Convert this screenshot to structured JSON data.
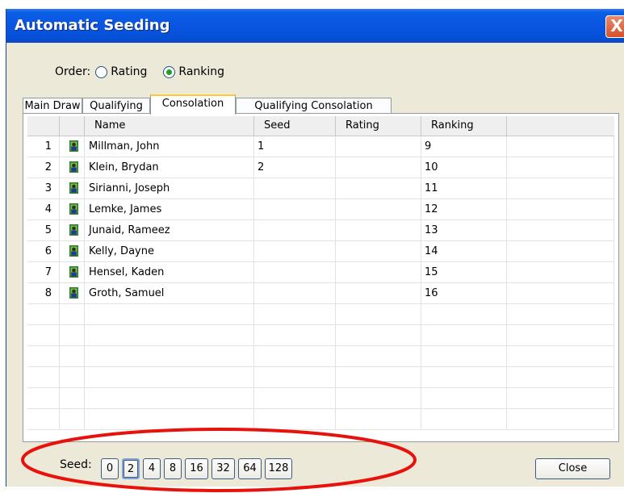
{
  "window": {
    "title": "Automatic Seeding",
    "close_glyph": "X"
  },
  "order": {
    "label": "Order:",
    "options": [
      {
        "label": "Rating",
        "checked": false
      },
      {
        "label": "Ranking",
        "checked": true
      }
    ]
  },
  "tabs": [
    {
      "label": "Main Draw",
      "active": false
    },
    {
      "label": "Qualifying",
      "active": false
    },
    {
      "label": "Consolation",
      "active": true
    },
    {
      "label": "Qualifying Consolation",
      "active": false
    }
  ],
  "table": {
    "columns": [
      "",
      "",
      "Name",
      "Seed",
      "Rating",
      "Ranking",
      ""
    ],
    "rows": [
      {
        "num": "1",
        "icon": "player-icon",
        "name": "Millman, John",
        "seed": "1",
        "rating": "",
        "ranking": "9"
      },
      {
        "num": "2",
        "icon": "player-icon",
        "name": "Klein, Brydan",
        "seed": "2",
        "rating": "",
        "ranking": "10"
      },
      {
        "num": "3",
        "icon": "player-icon",
        "name": "Sirianni, Joseph",
        "seed": "",
        "rating": "",
        "ranking": "11"
      },
      {
        "num": "4",
        "icon": "player-icon",
        "name": "Lemke, James",
        "seed": "",
        "rating": "",
        "ranking": "12"
      },
      {
        "num": "5",
        "icon": "player-icon",
        "name": "Junaid, Rameez",
        "seed": "",
        "rating": "",
        "ranking": "13"
      },
      {
        "num": "6",
        "icon": "player-icon",
        "name": "Kelly, Dayne",
        "seed": "",
        "rating": "",
        "ranking": "14"
      },
      {
        "num": "7",
        "icon": "player-icon",
        "name": "Hensel, Kaden",
        "seed": "",
        "rating": "",
        "ranking": "15"
      },
      {
        "num": "8",
        "icon": "player-icon",
        "name": "Groth, Samuel",
        "seed": "",
        "rating": "",
        "ranking": "16"
      }
    ]
  },
  "seed": {
    "label": "Seed:",
    "buttons": [
      "0",
      "2",
      "4",
      "8",
      "16",
      "32",
      "64",
      "128"
    ],
    "active": "2"
  },
  "close_button": "Close",
  "colors": {
    "titlebar": "#0955e0",
    "annotation": "#e8120c",
    "tab_highlight": "#ffc83c"
  }
}
